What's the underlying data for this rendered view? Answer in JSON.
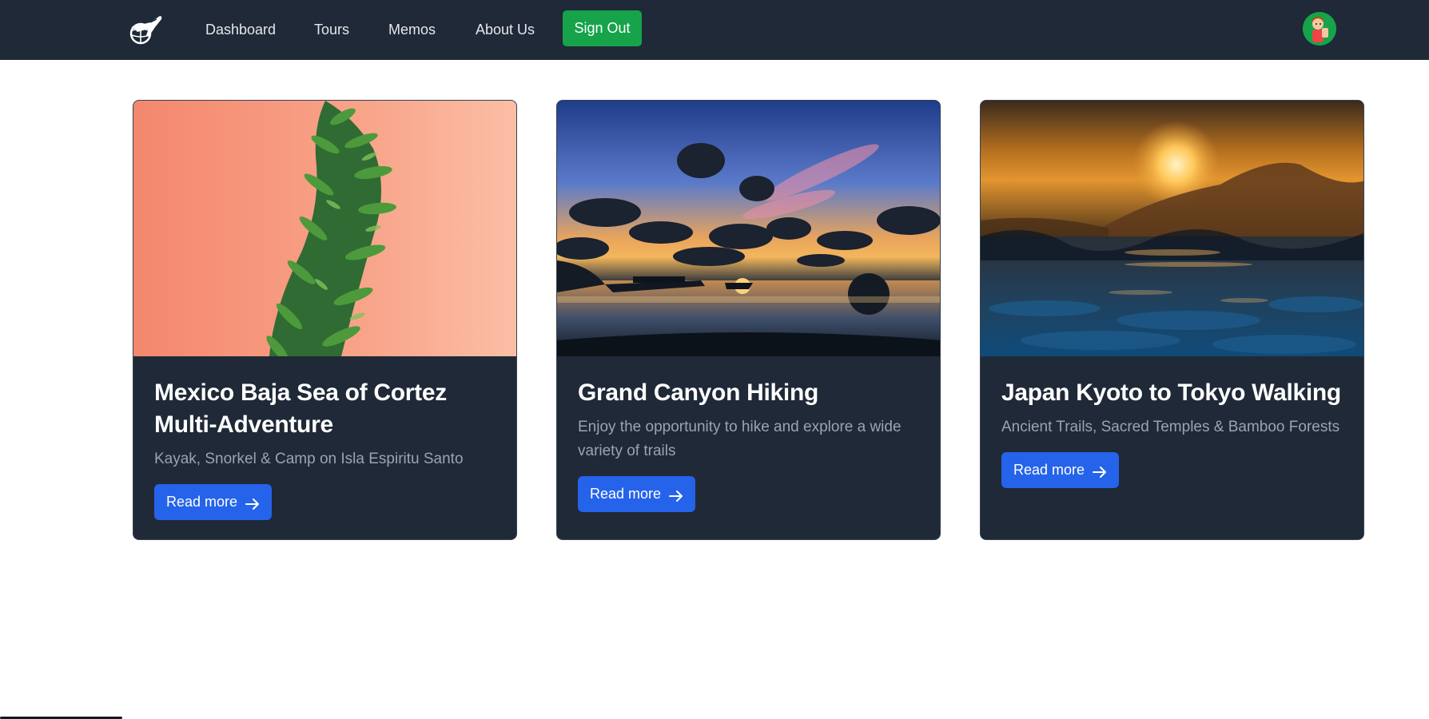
{
  "nav": {
    "logo_icon": "plane-globe-logo-icon",
    "links": [
      "Dashboard",
      "Tours",
      "Memos",
      "About Us"
    ],
    "sign_out": "Sign Out",
    "avatar_icon": "user-avatar-icon",
    "colors": {
      "bar": "#1f2937",
      "sign_out": "#16a34a"
    }
  },
  "cards": [
    {
      "title": "Mexico Baja Sea of Cortez Multi-Adventure",
      "description": "Kayak, Snorkel & Camp on Isla Espiritu Santo",
      "button": "Read more",
      "image_icon": "pine-branch-on-coral-photo"
    },
    {
      "title": "Grand Canyon Hiking",
      "description": "Enjoy the opportunity to hike and explore a wide variety of trails",
      "button": "Read more",
      "image_icon": "sunset-beach-boats-photo"
    },
    {
      "title": "Japan Kyoto to Tokyo Walking",
      "description": "Ancient Trails, Sacred Temples & Bamboo Forests",
      "button": "Read more",
      "image_icon": "sunset-ocean-waves-photo"
    }
  ],
  "colors": {
    "card_bg": "#1f2937",
    "button": "#2563eb",
    "desc_text": "#9ca3af"
  }
}
